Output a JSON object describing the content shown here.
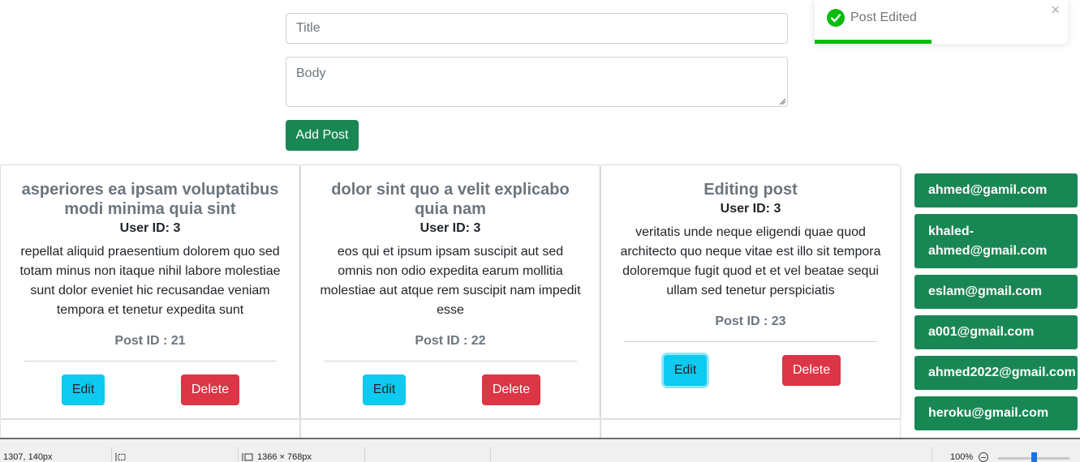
{
  "form": {
    "title_placeholder": "Title",
    "body_placeholder": "Body",
    "submit_label": "Add Post"
  },
  "posts": [
    {
      "title": "asperiores ea ipsam voluptatibus modi minima quia sint",
      "user": "User ID: 3",
      "body": "repellat aliquid praesentium dolorem quo sed totam minus non itaque nihil labore molestiae sunt dolor eveniet hic recusandae veniam tempora et tenetur expedita sunt",
      "post_id": "Post ID : 21",
      "edit_label": "Edit",
      "delete_label": "Delete"
    },
    {
      "title": "dolor sint quo a velit explicabo quia nam",
      "user": "User ID: 3",
      "body": "eos qui et ipsum ipsam suscipit aut sed omnis non odio expedita earum mollitia molestiae aut atque rem suscipit nam impedit esse",
      "post_id": "Post ID : 22",
      "edit_label": "Edit",
      "delete_label": "Delete"
    },
    {
      "title": "Editing post",
      "user": "User ID: 3",
      "body": "veritatis unde neque eligendi quae quod architecto quo neque vitae est illo sit tempora doloremque fugit quod et et vel beatae sequi ullam sed tenetur perspiciatis",
      "post_id": "Post ID : 23",
      "edit_label": "Edit",
      "delete_label": "Delete"
    }
  ],
  "users": [
    "ahmed@gamil.com",
    "khaled-ahmed@gmail.com",
    "eslam@gmail.com",
    "a001@gmail.com",
    "ahmed2022@gmail.com",
    "heroku@gmail.com"
  ],
  "toast": {
    "message": "Post Edited",
    "close": "×",
    "progress_fraction": 0.46,
    "color": "#07bc0c"
  },
  "statusbar": {
    "cursor": "1307, 140px",
    "viewport": "1366 × 768px",
    "zoom": "100%",
    "zoom_level": 0.5
  },
  "colors": {
    "success": "#198754",
    "info": "#0dcaf0",
    "danger": "#dc3545"
  }
}
